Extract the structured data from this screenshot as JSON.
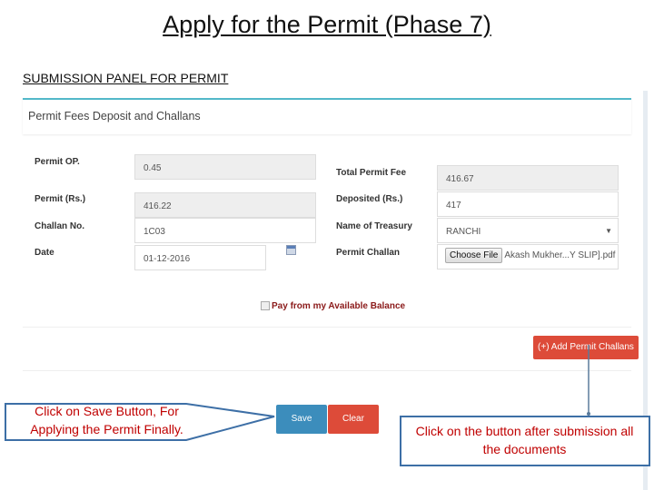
{
  "slide": {
    "title": "Apply for the Permit (Phase 7)",
    "subtitle": "SUBMISSION PANEL FOR PERMIT"
  },
  "panel": {
    "heading": "Permit Fees Deposit and Challans",
    "left_fields": [
      {
        "label": "Permit OP.",
        "value": "0.45",
        "readonly": true
      },
      {
        "label": "Permit (Rs.)",
        "value": "416.22",
        "readonly": true
      },
      {
        "label": "Challan No.",
        "value": "1C03",
        "readonly": false
      },
      {
        "label": "Date",
        "value": "01-12-2016",
        "readonly": false
      }
    ],
    "right_fields": [
      {
        "label": "Total Permit Fee",
        "value": "416.67",
        "readonly": true
      },
      {
        "label": "Deposited (Rs.)",
        "value": "417",
        "readonly": false
      },
      {
        "label": "Name of Treasury",
        "value": "RANCHI",
        "type": "select"
      },
      {
        "label": "Permit Challan",
        "button": "Choose File",
        "filename": "Akash Mukher...Y SLIP].pdf",
        "type": "file"
      }
    ],
    "checkbox_label": "Pay from my Available Balance",
    "checkbox_checked": false,
    "add_button": "(+) Add Permit Challans",
    "save_button": "Save",
    "clear_button": "Clear"
  },
  "callouts": {
    "save": "Click on Save Button, For Applying the Permit Finally.",
    "add": "Click on the button after submission all the documents"
  },
  "colors": {
    "save": "#3c8dbc",
    "danger": "#dd4b39",
    "callout_text": "#c00000",
    "callout_border": "#3d6fa6",
    "panel_accent": "#52b8c9"
  }
}
